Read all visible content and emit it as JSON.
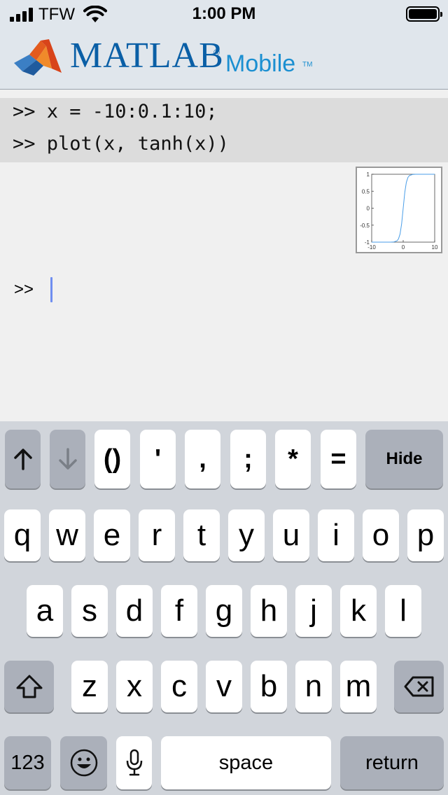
{
  "status_bar": {
    "carrier": "TFW",
    "time": "1:00 PM"
  },
  "header": {
    "brand": "MATLAB",
    "brand_reg": "®",
    "brand_sub": "Mobile",
    "brand_tm": "TM"
  },
  "console": {
    "history": [
      ">> x = -10:0.1:10;",
      ">> plot(x, tanh(x))"
    ],
    "prompt": ">>"
  },
  "plot": {
    "y_ticks": [
      "1",
      "0.5",
      "0",
      "-0.5",
      "-1"
    ],
    "x_ticks": [
      "-10",
      "0",
      "10"
    ]
  },
  "chart_data": {
    "type": "line",
    "title": "",
    "xlabel": "",
    "ylabel": "",
    "xlim": [
      -10,
      10
    ],
    "ylim": [
      -1,
      1
    ],
    "x_ticks": [
      -10,
      0,
      10
    ],
    "y_ticks": [
      -1,
      -0.5,
      0,
      0.5,
      1
    ],
    "series": [
      {
        "x": [
          -10,
          -8,
          -6,
          -4,
          -3,
          -2,
          -1.5,
          -1,
          -0.5,
          0,
          0.5,
          1,
          1.5,
          2,
          3,
          4,
          6,
          8,
          10
        ],
        "y": [
          -1,
          -1,
          -1,
          -0.999,
          -0.995,
          -0.964,
          -0.905,
          -0.762,
          -0.462,
          0,
          0.462,
          0.762,
          0.905,
          0.964,
          0.995,
          0.999,
          1,
          1,
          1
        ]
      }
    ],
    "line_color": "#4a9ee8"
  },
  "toolbar": {
    "up_icon": "arrow-up-icon",
    "down_icon": "arrow-down-icon",
    "keys": [
      "()",
      "'",
      ",",
      ";",
      "*",
      "="
    ],
    "hide": "Hide"
  },
  "keyboard": {
    "row1": [
      "q",
      "w",
      "e",
      "r",
      "t",
      "y",
      "u",
      "i",
      "o",
      "p"
    ],
    "row2": [
      "a",
      "s",
      "d",
      "f",
      "g",
      "h",
      "j",
      "k",
      "l"
    ],
    "row3": [
      "z",
      "x",
      "c",
      "v",
      "b",
      "n",
      "m"
    ],
    "numbers": "123",
    "space": "space",
    "return": "return"
  },
  "colors": {
    "header_bg": "#e0e6ec",
    "brand": "#0a5fa6",
    "caret": "#6f8ef0",
    "keyboard_bg": "#d1d5db"
  }
}
